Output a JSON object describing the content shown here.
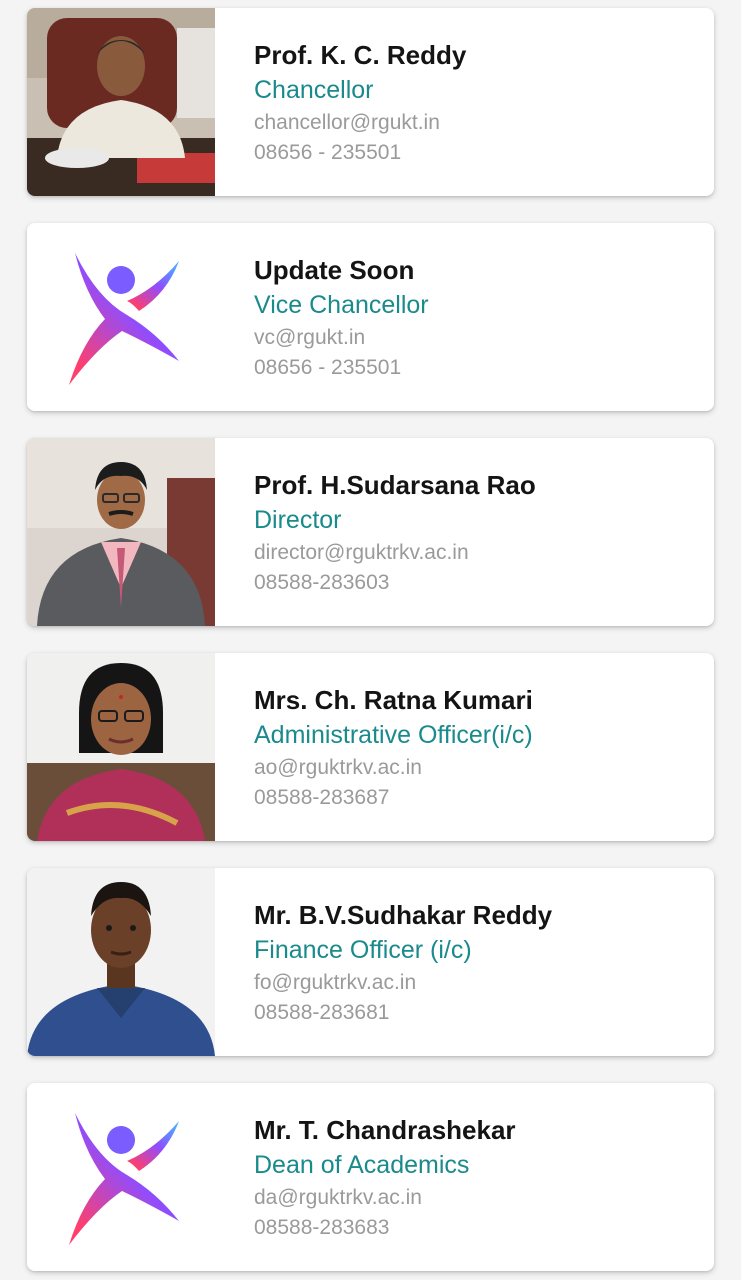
{
  "colors": {
    "name": "#141414",
    "role": "#1a8a8c",
    "meta": "#9a9a9a",
    "logo_gradient_start": "#7b5cff",
    "logo_gradient_end": "#ff3f6c"
  },
  "officers": [
    {
      "name": "Prof. K. C. Reddy",
      "role": "Chancellor",
      "email": "chancellor@rgukt.in",
      "phone": "08656 - 235501",
      "photo": "photo-portrait-man-office"
    },
    {
      "name": "Update Soon",
      "role": "Vice Chancellor",
      "email": "vc@rgukt.in",
      "phone": "08656 - 235501",
      "photo": "placeholder-person-logo-icon"
    },
    {
      "name": "Prof. H.Sudarsana Rao",
      "role": "Director",
      "email": "director@rguktrkv.ac.in",
      "phone": "08588-283603",
      "photo": "photo-portrait-man-suit"
    },
    {
      "name": "Mrs. Ch. Ratna Kumari",
      "role": "Administrative Officer(i/c)",
      "email": "ao@rguktrkv.ac.in",
      "phone": "08588-283687",
      "photo": "photo-portrait-woman-saree"
    },
    {
      "name": "Mr. B.V.Sudhakar Reddy",
      "role": "Finance Officer (i/c)",
      "email": "fo@rguktrkv.ac.in",
      "phone": "08588-283681",
      "photo": "photo-portrait-man-blue-shirt"
    },
    {
      "name": "Mr. T. Chandrashekar",
      "role": "Dean of Academics",
      "email": "da@rguktrkv.ac.in",
      "phone": "08588-283683",
      "photo": "placeholder-person-logo-icon"
    }
  ]
}
